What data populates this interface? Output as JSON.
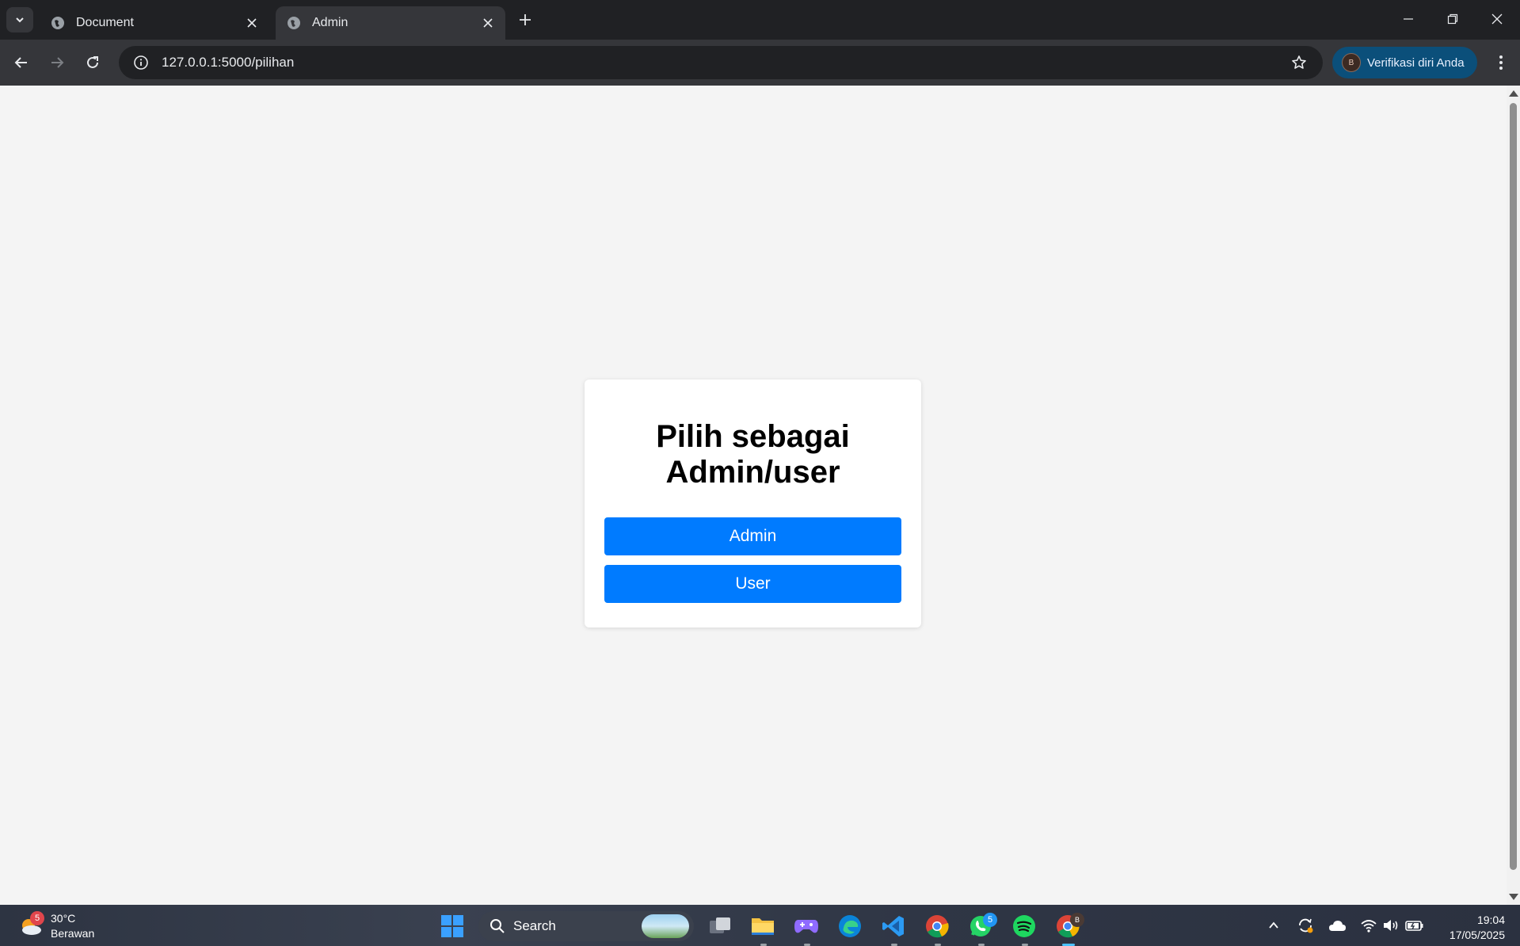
{
  "browser": {
    "tabs": [
      {
        "title": "Document",
        "active": false
      },
      {
        "title": "Admin",
        "active": true
      }
    ],
    "url": "127.0.0.1:5000/pilihan",
    "profile_label": "Verifikasi diri Anda",
    "profile_initial": "B"
  },
  "page": {
    "heading_line1": "Pilih sebagai",
    "heading_line2": "Admin/user",
    "admin_button": "Admin",
    "user_button": "User",
    "button_color": "#007bff",
    "background_color": "#f4f4f4"
  },
  "taskbar": {
    "weather_temp": "30°C",
    "weather_desc": "Berawan",
    "weather_badge": "5",
    "search_label": "Search",
    "whatsapp_badge": "5",
    "chrome_profile_badge": "B",
    "time": "19:04",
    "date": "17/05/2025"
  }
}
